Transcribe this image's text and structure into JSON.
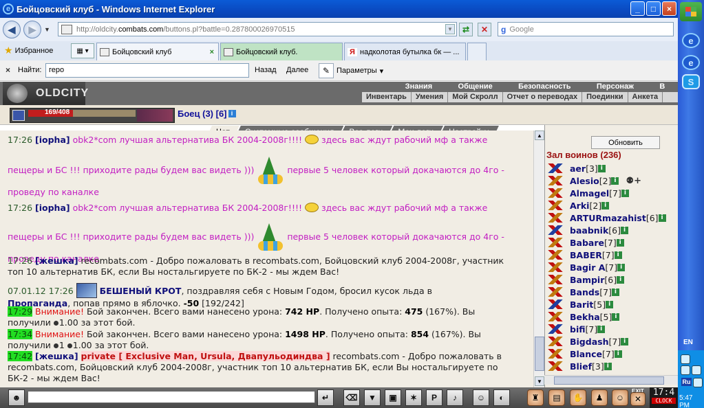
{
  "window": {
    "title": "Бойцовский клуб - Windows Internet Explorer"
  },
  "address": {
    "url_prefix": "http://oldcity.",
    "url_domain": "combats.com",
    "url_suffix": "/buttons.pl?battle=0.287800026970515",
    "search_placeholder": "Google",
    "search_brand": "g"
  },
  "tabs": {
    "favorites_label": "Избранное",
    "items": [
      {
        "label": "Бойцовский клуб",
        "close": "×"
      },
      {
        "label": "Бойцовский клуб.",
        "close": ""
      },
      {
        "label": "надколотая бутылка бк — ...",
        "close": "",
        "favicon": "Я"
      }
    ]
  },
  "findbar": {
    "close": "×",
    "label": "Найти:",
    "value": "геро",
    "prev": "Назад",
    "next": "Далее",
    "options": "Параметры"
  },
  "game": {
    "logo": "OLDCITY",
    "menu_top": [
      "Знания",
      "Общение",
      "Безопасность",
      "Персонаж",
      "В"
    ],
    "menu_bottom": [
      "Инвентарь",
      "Умения",
      "Мой Скролл",
      "Отчет о переводах",
      "Поединки",
      "Анкета"
    ],
    "hp": "169/408",
    "hp_fraction": 0.414,
    "fight_label": "Боец (3) [6]"
  },
  "chat_tabs": [
    "Чат",
    "Системные сообщения",
    "Все логи",
    "Мои логи",
    "Настройки"
  ],
  "chat": {
    "m1": {
      "time": "17:26",
      "nick": "[iopha]",
      "text_a": "obk2*com лучшая альтернатива БК 2004-2008г!!!!",
      "text_b": "здесь вас ждут рабочий мф а также"
    },
    "m2": {
      "text_a": "пещеры и БС !!! приходите рады будем вас видеть )))",
      "text_b": "первые 5 человек который докачаются до 4го -",
      "text_c": "проведу по каналке"
    },
    "m3": {
      "time": "17:26",
      "nick": "[iopha]",
      "text_a": "obk2*com лучшая альтернатива БК 2004-2008г!!!!",
      "text_b": "здесь вас ждут рабочий мф а также"
    },
    "m4": {
      "text_a": "пещеры и БС !!! приходите рады будем вас видеть )))",
      "text_b": "первые 5 человек который докачаются до 4го -",
      "text_c": "проведу по каналке"
    },
    "m5": {
      "time": "17:26",
      "nick": "[жешка]",
      "text": "recombats.com - Добро пожаловать в recombats.com, Бойцовский клуб 2004-2008г, участник",
      "text2": "топ 10 альтернатив БК, если Вы ностальгируете по БК-2 - мы ждем Вас!"
    },
    "m6": {
      "time": "07.01.12 17:26",
      "nick": "БЕШЕНЫЙ КРОТ",
      "text": ", поздравляя себя с Новым Годом, бросил кусок льда в",
      "target": "Пропаганда",
      "text2": ", попав прямо в яблочко.",
      "dmg": "-50",
      "hp": "[192/242]"
    },
    "m7": {
      "time": "17:29",
      "warn": "Внимание!",
      "text": "Бой закончен. Всего вами нанесено урона:",
      "dmg": "742 HP",
      "text2": ". Получено опыта:",
      "exp": "475",
      "pct": "(167%). Вы",
      "text3": "получили",
      "coin1": "1.00",
      "text4": "за этот бой."
    },
    "m8": {
      "time": "17:34",
      "warn": "Внимание!",
      "text": "Бой закончен. Всего вами нанесено урона:",
      "dmg": "1498 HP",
      "text2": ". Получено опыта:",
      "exp": "854",
      "pct": "(167%). Вы",
      "text3": "получили",
      "coin0": "1",
      "coin1": "1.00",
      "text4": "за этот бой."
    },
    "m9": {
      "time": "17:42",
      "nick": "[жешка]",
      "private": "private [ Exclusive Man, Ursula, Двапульодиндва ]",
      "text": "recombats.com - Добро пожаловать в",
      "text2": "recombats.com, Бойцовский клуб 2004-2008г, участник топ 10 альтернатив БК, если Вы ностальгируете по",
      "text3": "БК-2 - мы ждем Вас!"
    }
  },
  "right_panel": {
    "refresh": "Обновить",
    "hall": "Зал воинов (236)",
    "players": [
      {
        "name": "aer",
        "level": "[3]",
        "icon": "b"
      },
      {
        "name": "Alesio",
        "level": "[2]",
        "icon": "a",
        "extra": "add-friend"
      },
      {
        "name": "Almagel",
        "level": "[7]",
        "icon": "a"
      },
      {
        "name": "Arki",
        "level": "[2]",
        "icon": "a"
      },
      {
        "name": "ARTURmazahist",
        "level": "[6]",
        "icon": "a"
      },
      {
        "name": "baabnik",
        "level": "[6]",
        "icon": "b"
      },
      {
        "name": "Babare",
        "level": "[7]",
        "icon": "a"
      },
      {
        "name": "BABER",
        "level": "[7]",
        "icon": "a"
      },
      {
        "name": "Bagir A",
        "level": "[7]",
        "icon": "a"
      },
      {
        "name": "Bampir",
        "level": "[6]",
        "icon": "a"
      },
      {
        "name": "Bands",
        "level": "[7]",
        "icon": "a"
      },
      {
        "name": "Barit",
        "level": "[5]",
        "icon": "b"
      },
      {
        "name": "Bekha",
        "level": "[5]",
        "icon": "a"
      },
      {
        "name": "bifi",
        "level": "[7]",
        "icon": "b"
      },
      {
        "name": "Bigdash",
        "level": "[7]",
        "icon": "a"
      },
      {
        "name": "Blance",
        "level": "[7]",
        "icon": "a"
      },
      {
        "name": "Blief",
        "level": "[3]",
        "icon": "a"
      }
    ]
  },
  "bottom": {
    "clock": "17:4",
    "exit": "EXIT",
    "clock_label": "CLOCK"
  },
  "taskbar": {
    "lang": "EN",
    "tray_lang": "Ru",
    "time": "5:47 PM"
  }
}
